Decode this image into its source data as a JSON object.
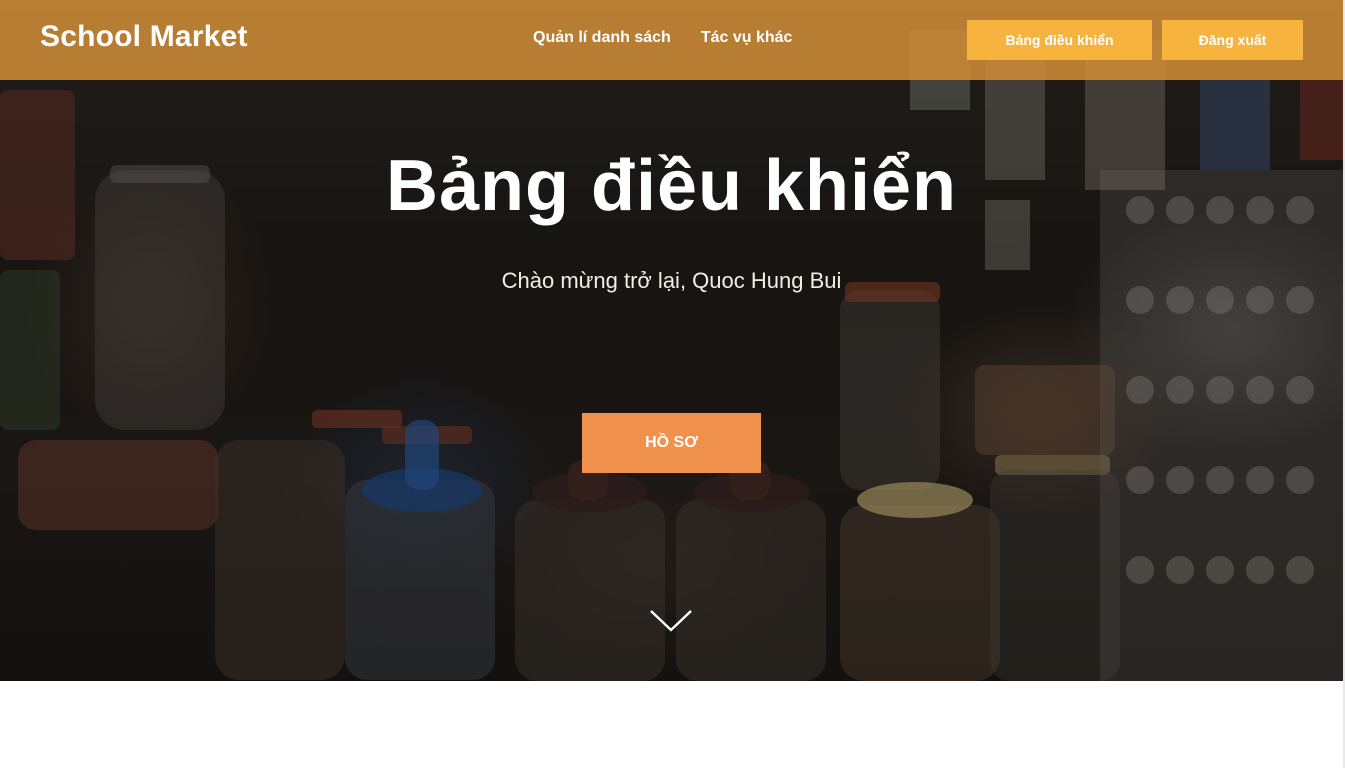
{
  "brand": {
    "name": "School Market"
  },
  "nav": {
    "links": [
      "Quản lí danh sách",
      "Tác vụ khác"
    ],
    "dashboard_button": "Bảng điều khiển",
    "logout_button": "Đăng xuất"
  },
  "hero": {
    "title": "Bảng điều khiển",
    "subtitle": "Chào mừng trở lại, Quoc Hung Bui",
    "cta_label": "HỒ SƠ",
    "scroll_icon": "chevron-down-icon"
  },
  "colors": {
    "navbar": "#cd8c37",
    "nav_button": "#f6b33e",
    "cta": "#f0914d",
    "text": "#ffffff"
  }
}
